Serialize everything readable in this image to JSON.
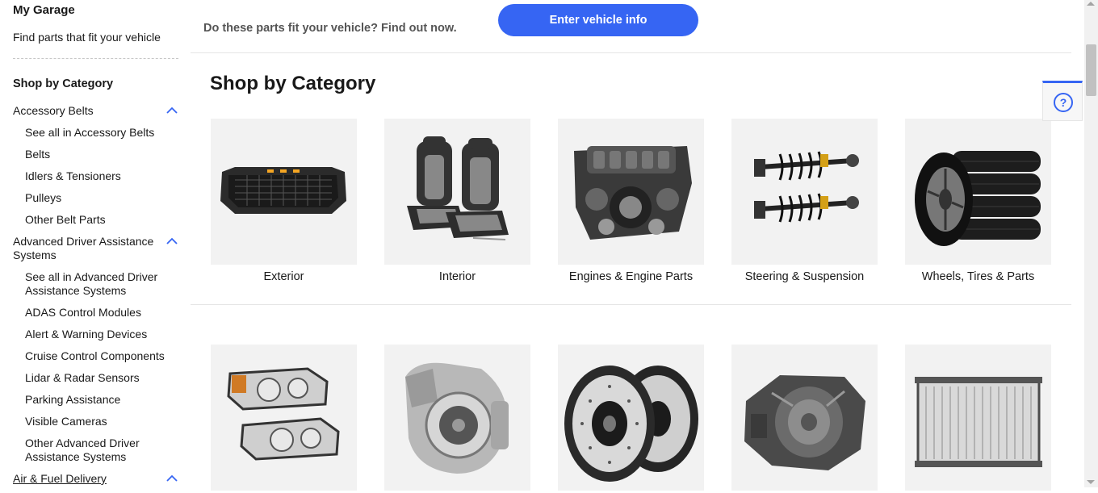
{
  "sidebar": {
    "garage_title": "My Garage",
    "garage_subtitle": "Find parts that fit your vehicle",
    "heading": "Shop by Category",
    "groups": [
      {
        "label": "Accessory Belts",
        "items": [
          "See all in Accessory Belts",
          "Belts",
          "Idlers & Tensioners",
          "Pulleys",
          "Other Belt Parts"
        ]
      },
      {
        "label": "Advanced Driver Assistance Systems",
        "items": [
          "See all in Advanced Driver Assistance Systems",
          "ADAS Control Modules",
          "Alert & Warning Devices",
          "Cruise Control Components",
          "Lidar & Radar Sensors",
          "Parking Assistance",
          "Visible Cameras",
          "Other Advanced Driver Assistance Systems"
        ]
      },
      {
        "label": "Air & Fuel Delivery",
        "items": []
      }
    ]
  },
  "fitment": {
    "prompt": "Do these parts fit your vehicle? Find out now.",
    "button_label": "Enter vehicle info"
  },
  "main": {
    "title": "Shop by Category",
    "row1": [
      "Exterior",
      "Interior",
      "Engines & Engine Parts",
      "Steering & Suspension",
      "Wheels, Tires & Parts"
    ],
    "row2_icons": [
      "headlights-image",
      "turbocharger-image",
      "brake-rotors-image",
      "transmission-image",
      "radiator-image"
    ]
  },
  "help": {
    "icon": "question-circle-icon"
  },
  "colors": {
    "accent": "#3665f3",
    "tile_bg": "#f2f2f2",
    "divider": "#e5e5e5"
  }
}
